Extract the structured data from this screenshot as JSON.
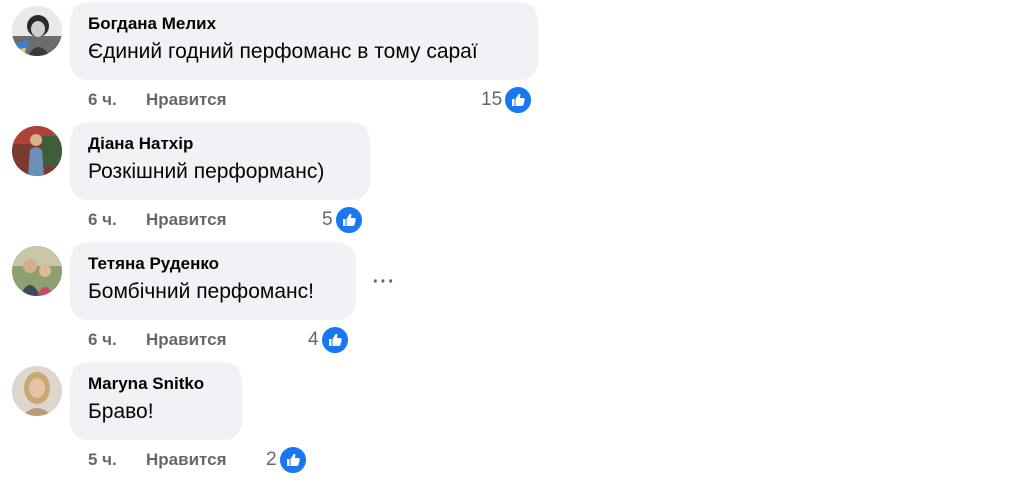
{
  "like_label": "Нравится",
  "colors": {
    "bubble": "#f0f2f5",
    "meta": "#65676b",
    "like": "#1877f2"
  },
  "comments": [
    {
      "author": "Богдана Мелих",
      "text": "Єдиний годний перфоманс в тому сараї",
      "time": "6 ч.",
      "likes": "15",
      "avatar": "avatar-bohdana"
    },
    {
      "author": "Діана Натхір",
      "text": "Розкішний перформанс)",
      "time": "6 ч.",
      "likes": "5",
      "avatar": "avatar-diana"
    },
    {
      "author": "Тетяна Руденко",
      "text": "Бомбічний перфоманс!",
      "time": "6 ч.",
      "likes": "4",
      "avatar": "avatar-tetiana",
      "more_icon": "ellipsis-icon",
      "more_label": "···"
    },
    {
      "author": "Maryna Snitko",
      "text": "Браво!",
      "time": "5 ч.",
      "likes": "2",
      "avatar": "avatar-maryna"
    }
  ]
}
